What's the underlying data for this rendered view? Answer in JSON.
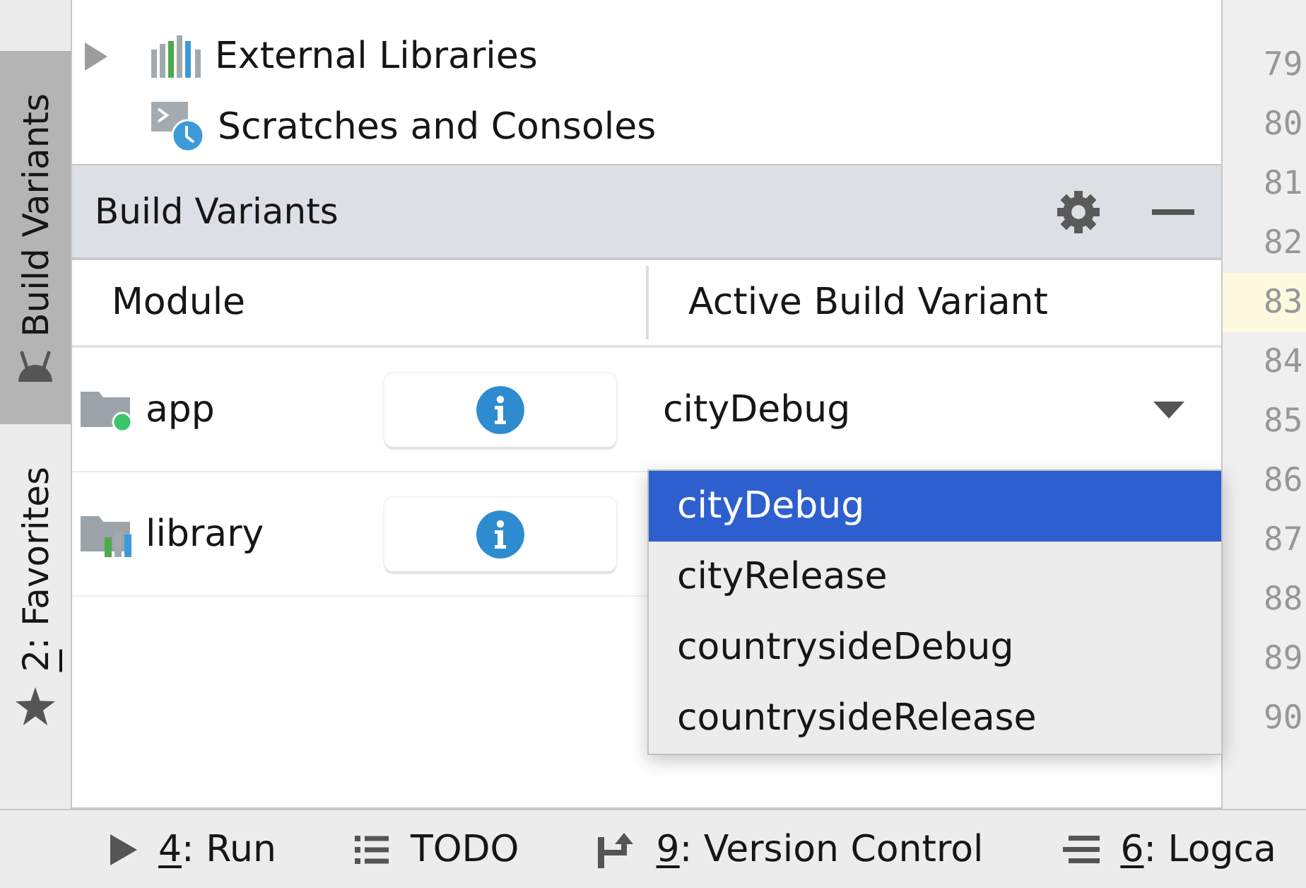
{
  "sidebar": {
    "tabs": [
      {
        "kind": "build_variants",
        "label": "Build Variants",
        "selected": true
      },
      {
        "kind": "favorites",
        "mnemonic": "2",
        "label": ": Favorites",
        "selected": false
      }
    ]
  },
  "project_tree": {
    "items": [
      {
        "kind": "libraries",
        "label": "External Libraries",
        "expanded": false
      },
      {
        "kind": "scratches",
        "label": "Scratches and Consoles"
      }
    ]
  },
  "build_variants": {
    "title": "Build Variants",
    "columns": [
      "Module",
      "Active Build Variant"
    ],
    "rows": [
      {
        "kind": "app",
        "module": "app",
        "variant": "cityDebug"
      },
      {
        "kind": "library",
        "module": "library"
      }
    ],
    "dropdown": {
      "open": true,
      "options": [
        {
          "label": "cityDebug",
          "selected": true
        },
        {
          "label": "cityRelease",
          "selected": false
        },
        {
          "label": "countrysideDebug",
          "selected": false
        },
        {
          "label": "countrysideRelease",
          "selected": false
        }
      ]
    }
  },
  "gutter": {
    "lines": [
      {
        "number": "79",
        "current": false
      },
      {
        "number": "80",
        "current": false
      },
      {
        "number": "81",
        "current": false
      },
      {
        "number": "82",
        "current": false
      },
      {
        "number": "83",
        "current": true
      },
      {
        "number": "84",
        "current": false
      },
      {
        "number": "85",
        "current": false
      },
      {
        "number": "86",
        "current": false
      },
      {
        "number": "87",
        "current": false
      },
      {
        "number": "88",
        "current": false
      },
      {
        "number": "89",
        "current": false
      },
      {
        "number": "90",
        "current": false
      }
    ]
  },
  "bottom_bar": {
    "items": [
      {
        "kind": "run",
        "mnemonic": "4",
        "label": ": Run"
      },
      {
        "kind": "todo",
        "label": "TODO"
      },
      {
        "kind": "vcs",
        "mnemonic": "9",
        "label": ": Version Control"
      },
      {
        "kind": "logcat",
        "mnemonic": "6",
        "label": ": Logca"
      }
    ]
  }
}
